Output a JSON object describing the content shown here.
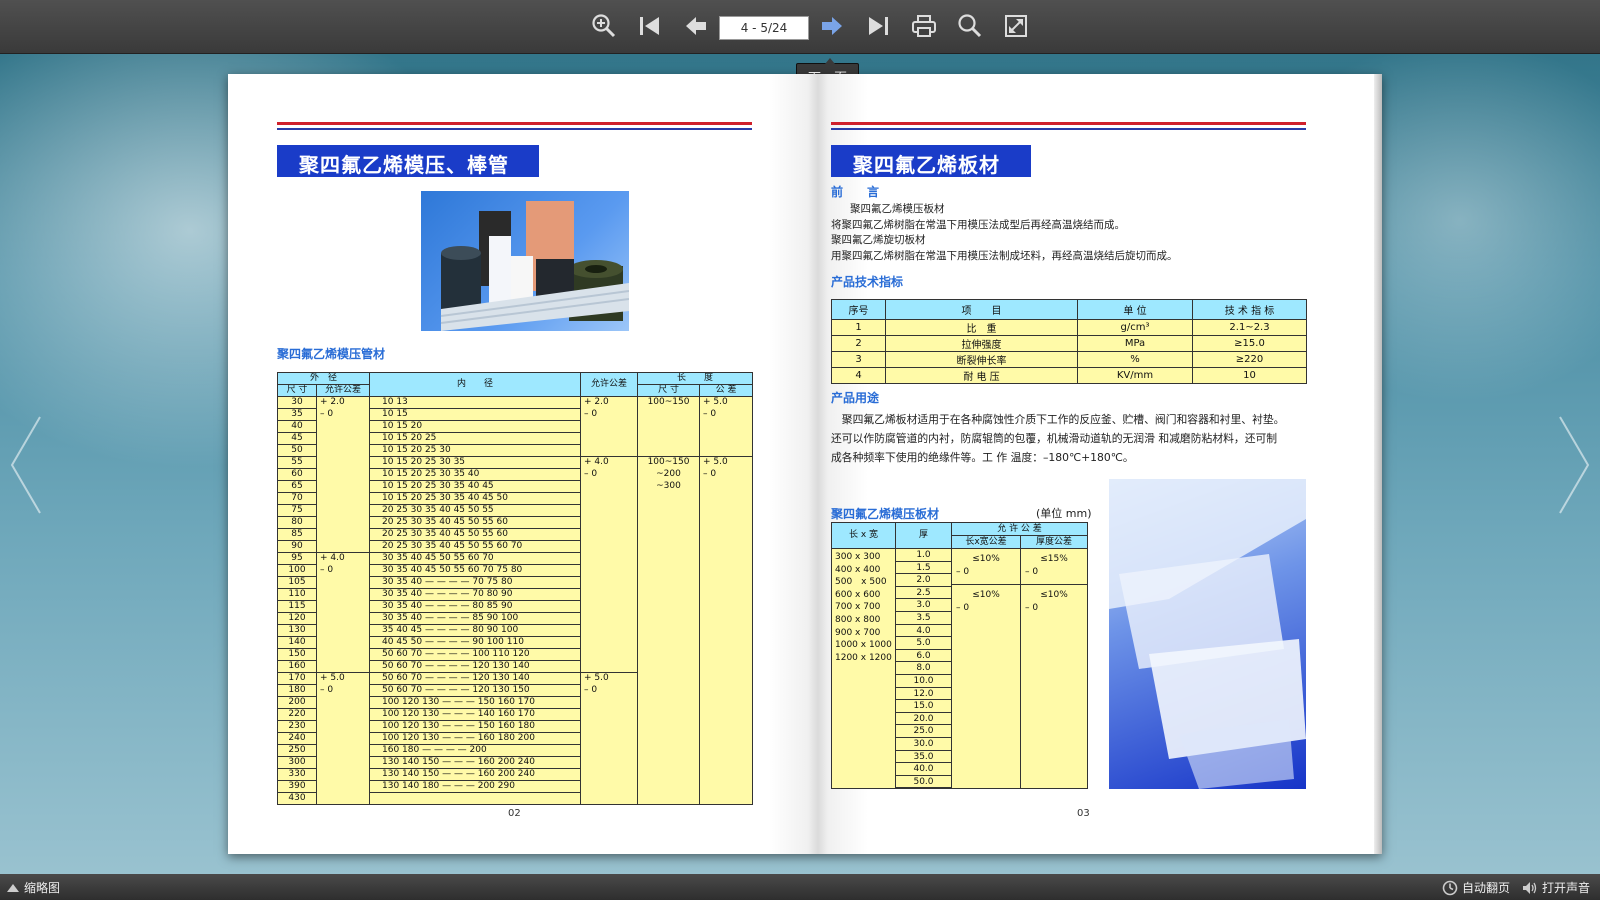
{
  "toolbar": {
    "page_indicator": "4 - 5/24",
    "tooltip": "下一页"
  },
  "bottom": {
    "thumbnails": "缩略图",
    "auto_flip": "自动翻页",
    "sound": "打开声音"
  },
  "left_page": {
    "title": "聚四氟乙烯模压、棒管",
    "subtitle": "聚四氟乙烯模压管材",
    "page_number": "02",
    "table": {
      "h_outer": "外　径",
      "h_size": "尺 寸",
      "h_tol": "允许公差",
      "h_inner": "内　　径",
      "h_allow": "允许公差",
      "h_length": "长　　度",
      "h_lsize": "尺 寸",
      "h_ltol": "公 差",
      "groups": [
        {
          "od_tol": [
            "+ 2.0",
            "– 0"
          ],
          "allow": [
            "+ 2.0",
            "– 0"
          ],
          "len": [
            "100~150"
          ],
          "len_tol": [
            "+ 5.0",
            "– 0"
          ],
          "rows": [
            [
              "30",
              "10  13"
            ],
            [
              "35",
              "10  15"
            ],
            [
              "40",
              "10  15  20"
            ],
            [
              "45",
              "10  15  20  25"
            ],
            [
              "50",
              "10  15  20  25  30"
            ]
          ]
        },
        {
          "od_tol": [],
          "allow": [
            "+ 4.0",
            "– 0"
          ],
          "len": [
            "100~150",
            "~200",
            "~300"
          ],
          "len_tol": [
            "+ 5.0",
            "– 0"
          ],
          "rows": [
            [
              "55",
              "10  15  20  25  30  35"
            ],
            [
              "60",
              "10  15  20  25  30  35  40"
            ],
            [
              "65",
              "10  15  20  25  30  35  40  45"
            ],
            [
              "70",
              "10  15  20  25  30  35  40  45  50"
            ],
            [
              "75",
              "20  25  30  35  40  45  50  55"
            ],
            [
              "80",
              "20  25  30  35  40  45  50  55  60"
            ],
            [
              "85",
              "20  25  30  35  40  45  50  55  60"
            ],
            [
              "90",
              "20  25  30  35  40  45  50  55  60  70"
            ]
          ]
        },
        {
          "od_tol": [
            "+ 4.0",
            "– 0"
          ],
          "allow": [],
          "len": [],
          "len_tol": [],
          "rows": [
            [
              "95",
              "30  35  40  45  50  55  60  70"
            ],
            [
              "100",
              "30  35  40  45  50  55  60  70  75  80"
            ],
            [
              "105",
              "30  35  40  —  —  —  —  70  75  80"
            ],
            [
              "110",
              "30  35  40  —  —  —  —  70  80  90"
            ],
            [
              "115",
              "30  35  40  —  —  —  —  80  85  90"
            ],
            [
              "120",
              "30  35  40  —  —  —  —  85  90  100"
            ],
            [
              "130",
              "35  40  45  —  —  —  —  80  90  100"
            ],
            [
              "140",
              "40  45  50  —  —  —  —  90  100  110"
            ],
            [
              "150",
              "50  60  70  —  —  —  —  100  110  120"
            ],
            [
              "160",
              "50  60  70  —  —  —  —  120  130  140"
            ]
          ]
        },
        {
          "od_tol": [
            "+ 5.0",
            "– 0"
          ],
          "allow": [
            "+ 5.0",
            "– 0"
          ],
          "len": [],
          "len_tol": [],
          "rows": [
            [
              "170",
              "50  60  70  —  —  —  —  120  130  140"
            ],
            [
              "180",
              "50  60  70  —  —  —  —  120  130  150"
            ],
            [
              "200",
              "100  120  130  —  —  —  150  160  170"
            ],
            [
              "220",
              "100  120  130  —  —  —  140  160  170"
            ],
            [
              "230",
              "100  120  130  —  —  —  150  160  180"
            ],
            [
              "240",
              "100  120  130  —  —  —  160  180  200"
            ],
            [
              "250",
              "160  180  —  —  —  —  200"
            ],
            [
              "300",
              "130  140  150  —  —  —  160  200  240"
            ],
            [
              "330",
              "130  140  150  —  —  —  160  200  240"
            ],
            [
              "390",
              "130  140  180  —  —  —  200          290"
            ],
            [
              "430",
              ""
            ]
          ]
        }
      ]
    }
  },
  "right_page": {
    "title": "聚四氟乙烯板材",
    "preface_heading": "前　　言",
    "preface": [
      "聚四氟乙烯模压板材",
      "将聚四氟乙烯树脂在常温下用模压法成型后再经高温烧结而成。",
      "聚四氟乙烯旋切板材",
      "用聚四氟乙烯树脂在常温下用模压法制成坯料，再经高温烧结后旋切而成。"
    ],
    "spec_heading": "产品技术指标",
    "spec_headers": [
      "序号",
      "项　　目",
      "单 位",
      "技 术 指 标"
    ],
    "spec_rows": [
      [
        "1",
        "比　重",
        "g/cm³",
        "2.1~2.3"
      ],
      [
        "2",
        "拉伸强度",
        "MPa",
        "≥15.0"
      ],
      [
        "3",
        "断裂伸长率",
        "%",
        "≥220"
      ],
      [
        "4",
        "耐 电 压",
        "KV/mm",
        "10"
      ]
    ],
    "use_heading": "产品用途",
    "use_text": [
      "　聚四氟乙烯板材适用于在各种腐蚀性介质下工作的反应釜、贮槽、阀门和容器和衬里、衬垫。",
      "还可以作防腐管道的内衬，防腐辊筒的包覆，机械滑动道轨的无润滑 和减磨防粘材料，还可制",
      "成各种频率下使用的绝缘件等。工 作 温度：–180℃+180℃。"
    ],
    "sheet_heading": "聚四氟乙烯模压板材",
    "sheet_unit": "(单位 mm)",
    "sheet_headers": {
      "lw": "长 x 宽",
      "thick": "厚",
      "allow": "允 许 公 差",
      "lw_tol": "长x宽公差",
      "t_tol": "厚度公差"
    },
    "sheet_sizes": [
      "300 x 300",
      "400 x 400",
      "500　x 500",
      "600 x 600",
      "700 x 700",
      "800 x 800",
      "900 x 700",
      "1000 x 1000",
      "1200 x 1200"
    ],
    "sheet_thick": [
      "1.0",
      "1.5",
      "2.0",
      "2.5",
      "3.0",
      "3.5",
      "4.0",
      "5.0",
      "6.0",
      "8.0",
      "10.0",
      "12.0",
      "15.0",
      "20.0",
      "25.0",
      "30.0",
      "35.0",
      "40.0",
      "50.0"
    ],
    "tol_a": [
      "≤10%",
      "– 0"
    ],
    "tol_b": [
      "≤15%",
      "– 0"
    ],
    "tol_c": [
      "≤10%",
      "– 0"
    ],
    "tol_d": [
      "≤10%",
      "– 0"
    ],
    "page_number": "03"
  }
}
